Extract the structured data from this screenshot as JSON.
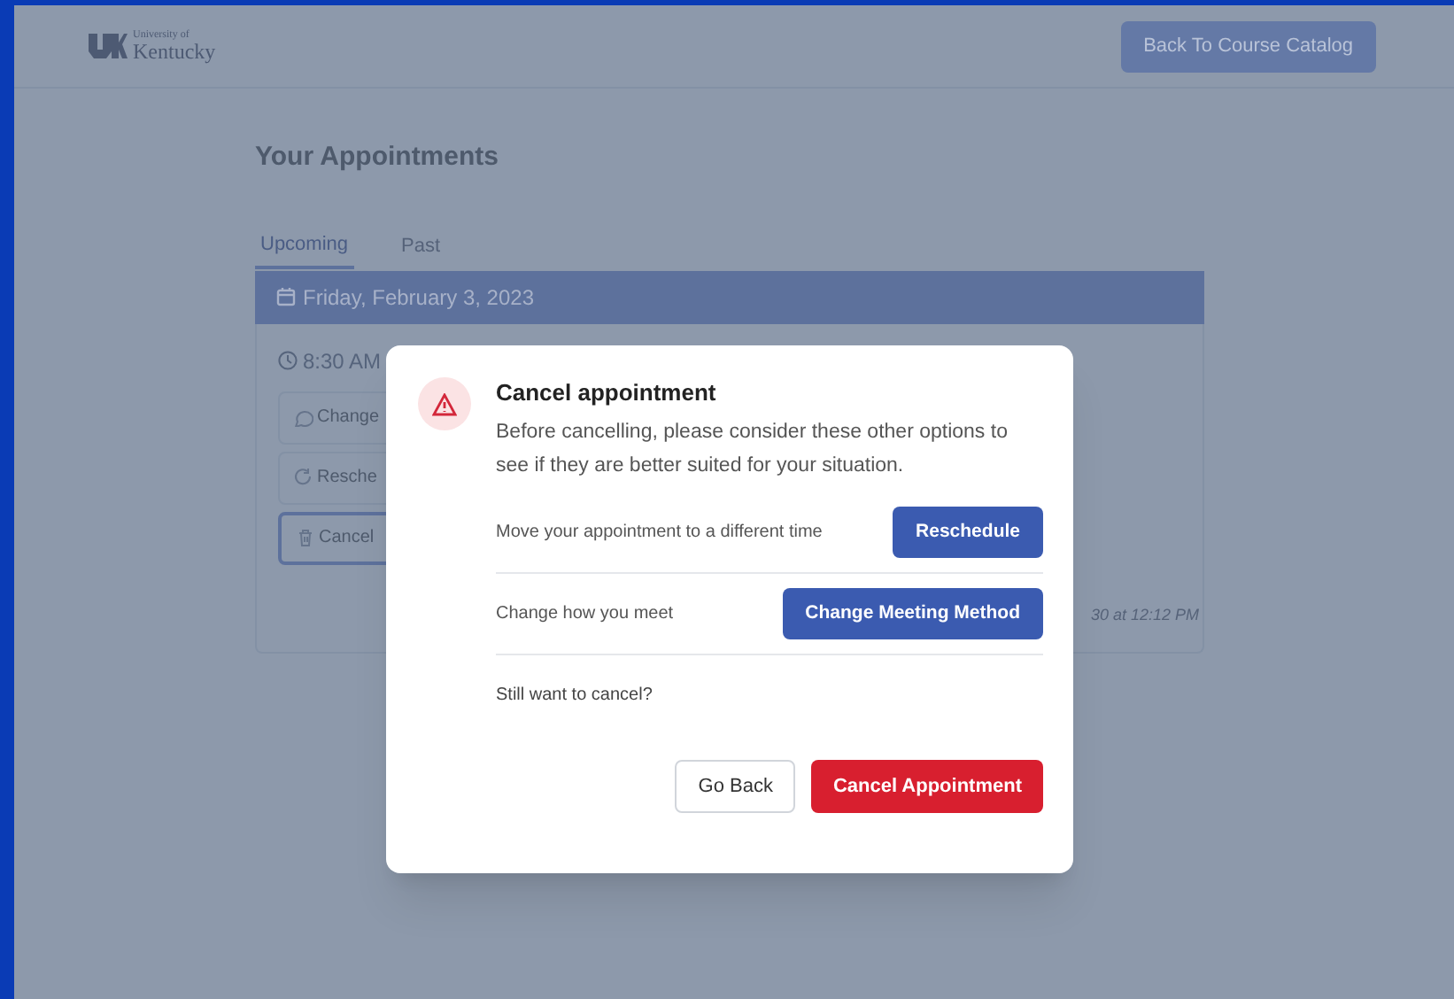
{
  "header": {
    "logo_small": "University of",
    "logo_name": "Kentucky",
    "back_button": "Back To Course Catalog"
  },
  "page_title": "Your Appointments",
  "tabs": [
    {
      "label": "Upcoming",
      "selected": true
    },
    {
      "label": "Past",
      "selected": false
    }
  ],
  "day": {
    "date": "Friday, February 3, 2023",
    "time": "8:30 AM",
    "actions": [
      {
        "label": "Change",
        "selected": false
      },
      {
        "label": "Resche",
        "selected": false
      },
      {
        "label": "Cancel",
        "selected": true
      }
    ],
    "note": "30 at 12:12 PM"
  },
  "dialog": {
    "title": "Cancel appointment",
    "message": "Before cancelling, please consider these other options to see if they are better suited for your situation.",
    "options": [
      {
        "text": "Move your appointment to a different time",
        "button": "Reschedule"
      },
      {
        "text": "Change how you meet",
        "button": "Change Meeting Method"
      }
    ],
    "question": "Still want to cancel?",
    "go_back": "Go Back",
    "confirm": "Cancel Appointment"
  }
}
